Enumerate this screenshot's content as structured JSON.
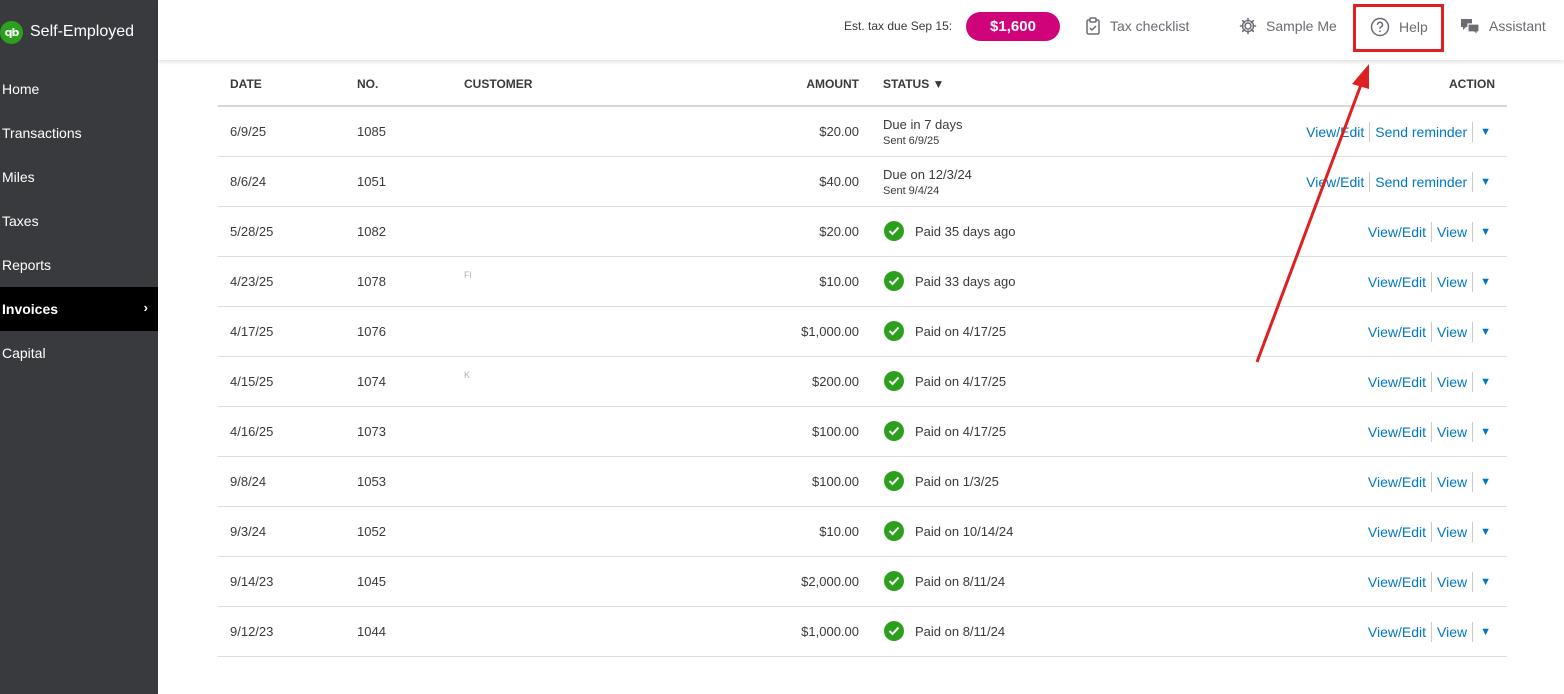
{
  "app": {
    "brand_logo": "qb",
    "brand_name": "Self-Employed"
  },
  "sidebar": {
    "items": [
      {
        "label": "Home",
        "active": false
      },
      {
        "label": "Transactions",
        "active": false
      },
      {
        "label": "Miles",
        "active": false
      },
      {
        "label": "Taxes",
        "active": false
      },
      {
        "label": "Reports",
        "active": false
      },
      {
        "label": "Invoices",
        "active": true
      },
      {
        "label": "Capital",
        "active": false
      }
    ],
    "chevron": "›"
  },
  "topbar": {
    "tax_due_label": "Est. tax due Sep 15:",
    "tax_due_amount": "$1,600",
    "tax_checklist": "Tax checklist",
    "sample_me": "Sample Me",
    "help": "Help",
    "assistant": "Assistant"
  },
  "table": {
    "headers": {
      "date": "DATE",
      "no": "NO.",
      "customer": "CUSTOMER",
      "amount": "AMOUNT",
      "status": "STATUS ▼",
      "action": "ACTION"
    },
    "rows": [
      {
        "date": "6/9/25",
        "no": "1085",
        "customer": "",
        "amount": "$20.00",
        "status_type": "due",
        "status": "Due in 7 days",
        "sub": "Sent 6/9/25",
        "primary": "View/Edit",
        "secondary": "Send reminder"
      },
      {
        "date": "8/6/24",
        "no": "1051",
        "customer": "",
        "amount": "$40.00",
        "status_type": "due",
        "status": "Due on 12/3/24",
        "sub": "Sent 9/4/24",
        "primary": "View/Edit",
        "secondary": "Send reminder"
      },
      {
        "date": "5/28/25",
        "no": "1082",
        "customer": "",
        "amount": "$20.00",
        "status_type": "paid",
        "status": "Paid 35 days ago",
        "sub": "",
        "primary": "View/Edit",
        "secondary": "View"
      },
      {
        "date": "4/23/25",
        "no": "1078",
        "customer": "Fl",
        "amount": "$10.00",
        "status_type": "paid",
        "status": "Paid 33 days ago",
        "sub": "",
        "primary": "View/Edit",
        "secondary": "View"
      },
      {
        "date": "4/17/25",
        "no": "1076",
        "customer": "",
        "amount": "$1,000.00",
        "status_type": "paid",
        "status": "Paid on 4/17/25",
        "sub": "",
        "primary": "View/Edit",
        "secondary": "View"
      },
      {
        "date": "4/15/25",
        "no": "1074",
        "customer": "K",
        "amount": "$200.00",
        "status_type": "paid",
        "status": "Paid on 4/17/25",
        "sub": "",
        "primary": "View/Edit",
        "secondary": "View"
      },
      {
        "date": "4/16/25",
        "no": "1073",
        "customer": "",
        "amount": "$100.00",
        "status_type": "paid",
        "status": "Paid on 4/17/25",
        "sub": "",
        "primary": "View/Edit",
        "secondary": "View"
      },
      {
        "date": "9/8/24",
        "no": "1053",
        "customer": "",
        "amount": "$100.00",
        "status_type": "paid",
        "status": "Paid on 1/3/25",
        "sub": "",
        "primary": "View/Edit",
        "secondary": "View"
      },
      {
        "date": "9/3/24",
        "no": "1052",
        "customer": "",
        "amount": "$10.00",
        "status_type": "paid",
        "status": "Paid on 10/14/24",
        "sub": "",
        "primary": "View/Edit",
        "secondary": "View"
      },
      {
        "date": "9/14/23",
        "no": "1045",
        "customer": "",
        "amount": "$2,000.00",
        "status_type": "paid",
        "status": "Paid on 8/11/24",
        "sub": "",
        "primary": "View/Edit",
        "secondary": "View"
      },
      {
        "date": "9/12/23",
        "no": "1044",
        "customer": "",
        "amount": "$1,000.00",
        "status_type": "paid",
        "status": "Paid on 8/11/24",
        "sub": "",
        "primary": "View/Edit",
        "secondary": "View"
      }
    ]
  },
  "annotation": {
    "highlight_color": "#e02020",
    "target": "Help"
  },
  "colors": {
    "sidebar_bg": "#393a3d",
    "brand_green": "#2ca01c",
    "tax_pill": "#d0037b",
    "link_blue": "#0077c5",
    "paid_green": "#2ca01c"
  }
}
